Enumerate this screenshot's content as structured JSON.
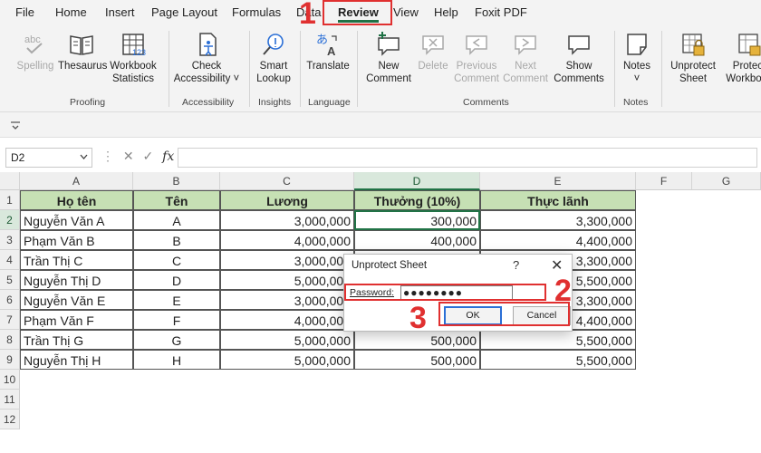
{
  "menu": {
    "tabs": [
      "File",
      "Home",
      "Insert",
      "Page Layout",
      "Formulas",
      "Data",
      "Review",
      "View",
      "Help",
      "Foxit PDF"
    ],
    "active": "Review"
  },
  "ribbon": {
    "spelling": "Spelling",
    "thesaurus": "Thesaurus",
    "workbook_statistics": [
      "Workbook",
      "Statistics"
    ],
    "proofing": "Proofing",
    "check_accessibility": [
      "Check",
      "Accessibility ˅"
    ],
    "accessibility": "Accessibility",
    "smart_lookup": [
      "Smart",
      "Lookup"
    ],
    "insights": "Insights",
    "translate": "Translate",
    "language": "Language",
    "new_comment": [
      "New",
      "Comment"
    ],
    "delete": "Delete",
    "previous_comment": [
      "Previous",
      "Comment"
    ],
    "next_comment": [
      "Next",
      "Comment"
    ],
    "show_comments": [
      "Show",
      "Comments"
    ],
    "comments": "Comments",
    "notes_btn": "Notes",
    "notes_caret": "˅",
    "notes": "Notes",
    "unprotect_sheet": [
      "Unprotect",
      "Sheet"
    ],
    "protect_workbook": [
      "Protect",
      "Workbook"
    ],
    "icon_spelling_text": "abc"
  },
  "formula_bar": {
    "name_box": "D2",
    "fx": "fx"
  },
  "grid": {
    "columns": [
      "A",
      "B",
      "C",
      "D",
      "E",
      "F",
      "G"
    ],
    "selected_column": "D",
    "rows": [
      "1",
      "2",
      "3",
      "4",
      "5",
      "6",
      "7",
      "8",
      "9",
      "10",
      "11",
      "12"
    ],
    "headers": [
      "Họ tên",
      "Tên",
      "Lương",
      "Thưởng (10%)",
      "Thực lãnh"
    ],
    "data": [
      [
        "Nguyễn Văn A",
        "A",
        "3,000,000",
        "300,000",
        "3,300,000"
      ],
      [
        "Phạm Văn B",
        "B",
        "4,000,000",
        "400,000",
        "4,400,000"
      ],
      [
        "Trần Thị C",
        "C",
        "3,000,000",
        "",
        "3,300,000"
      ],
      [
        "Nguyễn Thị D",
        "D",
        "5,000,000",
        "",
        "5,500,000"
      ],
      [
        "Nguyễn Văn E",
        "E",
        "3,000,000",
        "",
        "3,300,000"
      ],
      [
        "Phạm Văn F",
        "F",
        "4,000,000",
        "",
        "4,400,000"
      ],
      [
        "Trần Thị G",
        "G",
        "5,000,000",
        "500,000",
        "5,500,000"
      ],
      [
        "Nguyễn Thị H",
        "H",
        "5,000,000",
        "500,000",
        "5,500,000"
      ]
    ]
  },
  "dialog": {
    "title": "Unprotect Sheet",
    "help": "?",
    "close": "✕",
    "password_label": "Password:",
    "password_value": "●●●●●●●●",
    "ok": "OK",
    "cancel": "Cancel"
  },
  "annotations": [
    "1",
    "2",
    "3"
  ],
  "colors": {
    "accent": "#217346",
    "header_fill": "#c6e0b4",
    "annotation": "#e03030"
  }
}
